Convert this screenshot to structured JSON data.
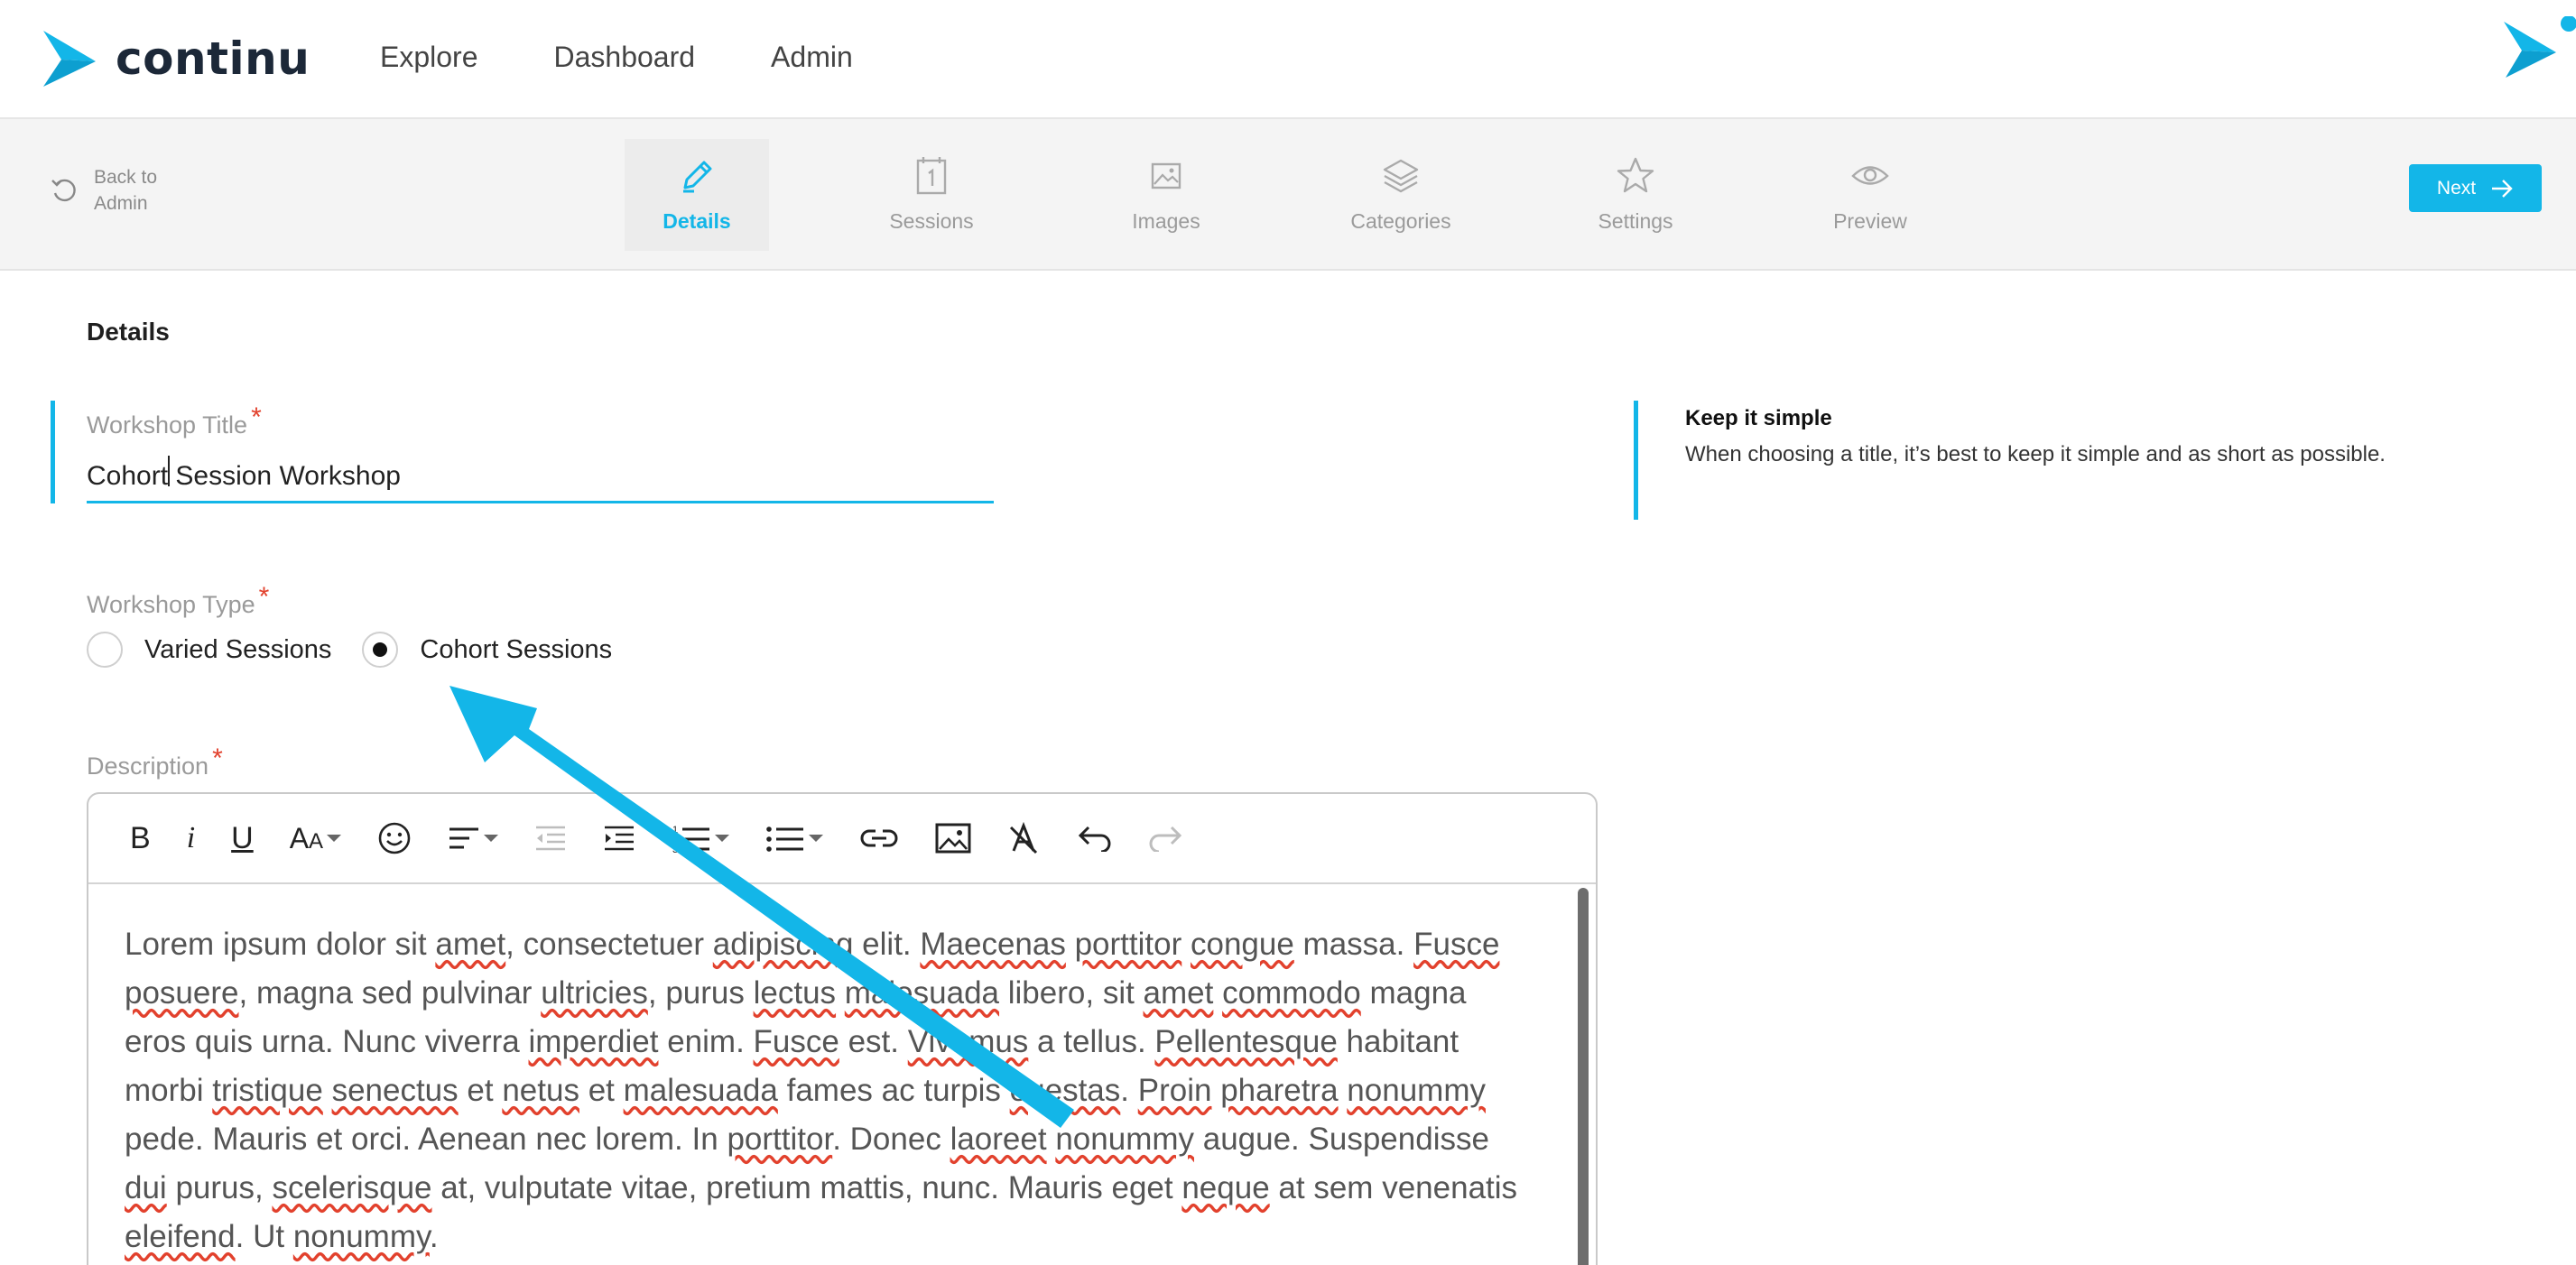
{
  "brand": {
    "name": "continu",
    "color": "#13b6e8"
  },
  "topnav": {
    "links": [
      "Explore",
      "Dashboard",
      "Admin"
    ]
  },
  "stepbar": {
    "back_label_line1": "Back to",
    "back_label_line2": "Admin",
    "steps": [
      {
        "label": "Details",
        "icon": "pencil-icon",
        "active": true
      },
      {
        "label": "Sessions",
        "icon": "calendar-icon",
        "active": false
      },
      {
        "label": "Images",
        "icon": "image-icon",
        "active": false
      },
      {
        "label": "Categories",
        "icon": "layers-icon",
        "active": false
      },
      {
        "label": "Settings",
        "icon": "star-icon",
        "active": false
      },
      {
        "label": "Preview",
        "icon": "eye-icon",
        "active": false
      }
    ],
    "next_label": "Next"
  },
  "form": {
    "section_title": "Details",
    "title_label": "Workshop Title",
    "title_value": "Cohort Session Workshop",
    "required_mark": "*",
    "type_label": "Workshop Type",
    "type_options": [
      "Varied Sessions",
      "Cohort Sessions"
    ],
    "type_selected": "Cohort Sessions",
    "description_label": "Description"
  },
  "tip": {
    "title": "Keep it simple",
    "text": "When choosing a title, it’s best to keep it simple and as short as possible."
  },
  "editor": {
    "toolbar": [
      "bold",
      "italic",
      "underline",
      "font-size",
      "emoji",
      "align",
      "outdent",
      "indent",
      "ordered-list",
      "bullet-list",
      "link",
      "image",
      "clear-format",
      "undo",
      "redo"
    ],
    "body": "Lorem ipsum dolor sit amet, consectetuer adipiscing elit. Maecenas porttitor congue massa. Fusce posuere, magna sed pulvinar ultricies, purus lectus malesuada libero, sit amet commodo magna eros quis urna. Nunc viverra imperdiet enim. Fusce est. Vivamus a tellus. Pellentesque habitant morbi tristique senectus et netus et malesuada fames ac turpis egestas. Proin pharetra nonummy pede. Mauris et orci. Aenean nec lorem. In porttitor. Donec laoreet nonummy augue. Suspendisse dui purus, scelerisque at, vulputate vitae, pretium mattis, nunc. Mauris eget neque at sem venenatis eleifend. Ut nonummy."
  }
}
